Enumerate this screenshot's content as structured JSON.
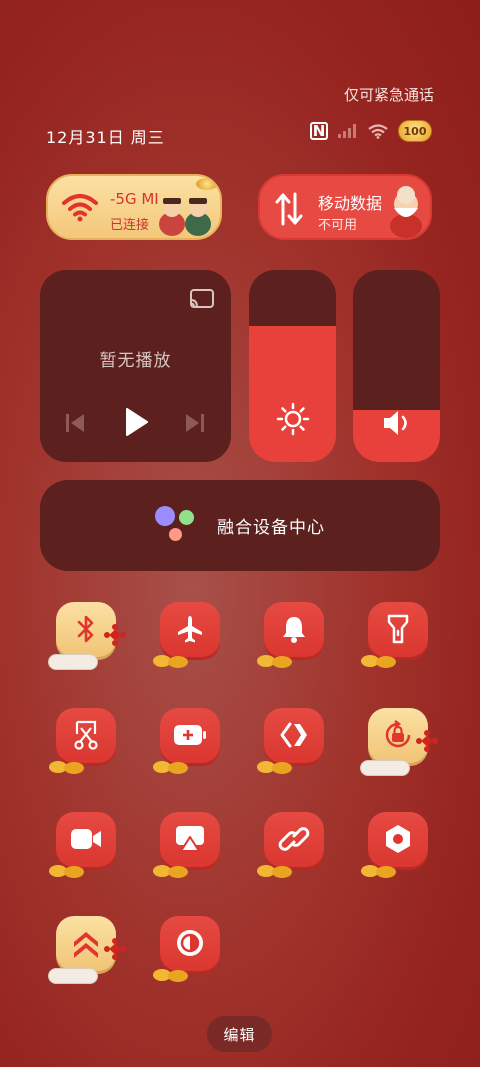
{
  "status_bar": {
    "emergency_text": "仅可紧急通话",
    "date_text": "12月31日 周三",
    "nfc_label": "N",
    "battery_text": "100"
  },
  "wifi_tile": {
    "name": "-5G   MI",
    "status": "已连接",
    "icon": "wifi-icon"
  },
  "data_tile": {
    "name": "移动数据",
    "status": "不可用",
    "icon": "mobile-data-icon"
  },
  "media": {
    "no_playback": "暂无播放",
    "icons": [
      "cast-icon",
      "previous-icon",
      "play-icon",
      "next-icon"
    ]
  },
  "brightness": {
    "level": 0.71,
    "icon": "sun-icon"
  },
  "volume": {
    "level": 0.27,
    "icon": "speaker-icon"
  },
  "device_center": {
    "label": "融合设备中心"
  },
  "toggles": [
    {
      "name": "bluetooth",
      "icon": "bluetooth-icon",
      "active": false
    },
    {
      "name": "airplane",
      "icon": "airplane-icon",
      "active": true
    },
    {
      "name": "bell",
      "icon": "bell-icon",
      "active": true
    },
    {
      "name": "flashlight",
      "icon": "flashlight-icon",
      "active": true
    },
    {
      "name": "screenshot",
      "icon": "scissors-icon",
      "active": true
    },
    {
      "name": "battery-saver",
      "icon": "battery-plus-icon",
      "active": true
    },
    {
      "name": "nearby-share",
      "icon": "share-arrows-icon",
      "active": true
    },
    {
      "name": "rotation-lock",
      "icon": "lock-rotate-icon",
      "active": false
    },
    {
      "name": "screen-record",
      "icon": "video-camera-icon",
      "active": true
    },
    {
      "name": "screen-cast",
      "icon": "cast-screen-icon",
      "active": true
    },
    {
      "name": "link",
      "icon": "link-icon",
      "active": true
    },
    {
      "name": "settings",
      "icon": "hexagon-gear-icon",
      "active": true
    },
    {
      "name": "performance",
      "icon": "double-chevron-up-icon",
      "active": false
    },
    {
      "name": "dark-mode",
      "icon": "contrast-icon",
      "active": true
    }
  ],
  "edit_button": "编辑",
  "colors": {
    "background": "#a0332c",
    "tile_red": "#e64a42",
    "tile_gold": "#f3c77b",
    "panel_dark": "#5c211e"
  }
}
